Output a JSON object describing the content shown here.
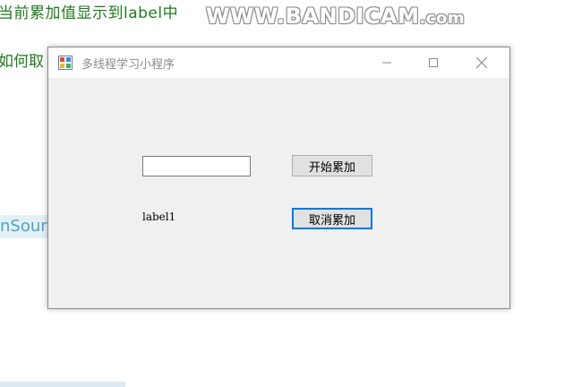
{
  "background": {
    "line1": "当前累加值显示到label中",
    "line2": "如何取",
    "line3": "nSour"
  },
  "watermark": {
    "brand": "WWW.BANDICAM",
    "suffix": ".com"
  },
  "window": {
    "title": "多线程学习小程序",
    "textbox_value": "",
    "start_button_label": "开始累加",
    "cancel_button_label": "取消累加",
    "label_text": "label1"
  }
}
